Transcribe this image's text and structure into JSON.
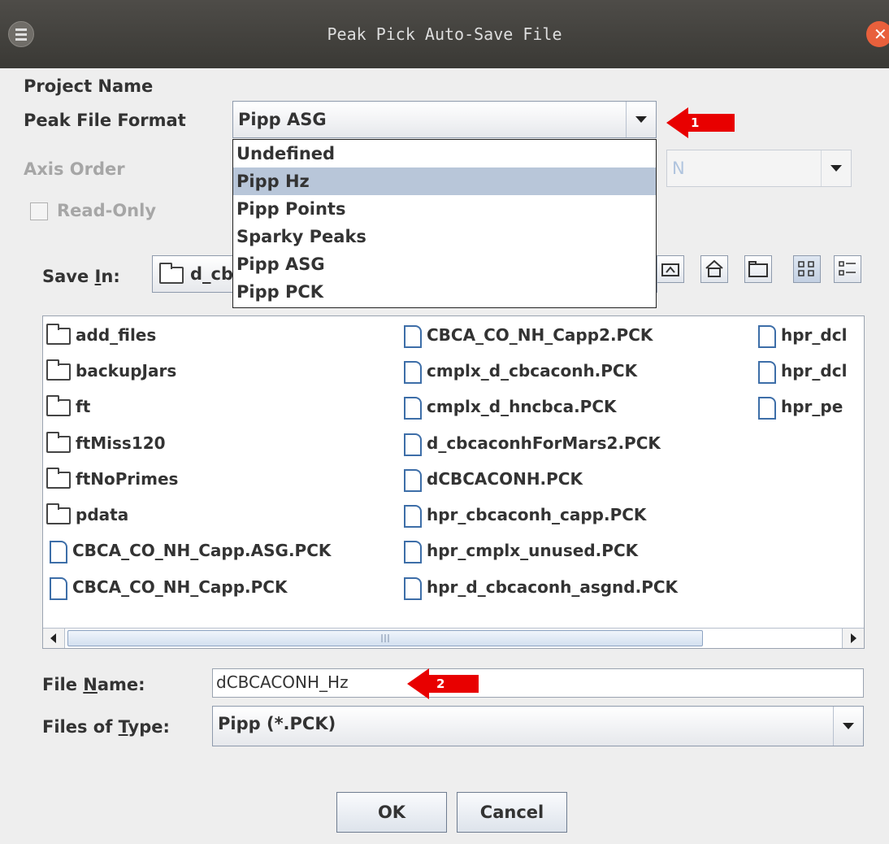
{
  "window": {
    "title": "Peak Pick Auto-Save File"
  },
  "fields": {
    "project_name_label": "Project Name",
    "peak_file_format_label": "Peak File Format",
    "peak_file_format_value": "Pipp ASG",
    "axis_order_label": "Axis Order",
    "axis_order_value": "N",
    "read_only_label": "Read-Only"
  },
  "format_options": [
    "Undefined",
    "Pipp Hz",
    "Pipp Points",
    "Sparky Peaks",
    "Pipp ASG",
    "Pipp PCK"
  ],
  "format_highlighted": "Pipp Hz",
  "save_in": {
    "label_pre": "Save ",
    "label_mnemonic": "I",
    "label_post": "n:",
    "value": "d_cb"
  },
  "files": {
    "col1": [
      "add_files",
      "backupJars",
      "ft",
      "ftMiss120",
      "ftNoPrimes",
      "pdata",
      "CBCA_CO_NH_Capp.ASG.PCK",
      "CBCA_CO_NH_Capp.PCK"
    ],
    "col2": [
      "CBCA_CO_NH_Capp2.PCK",
      "cmplx_d_cbcaconh.PCK",
      "cmplx_d_hncbca.PCK",
      "d_cbcaconhForMars2.PCK",
      "dCBCACONH.PCK",
      "hpr_cbcaconh_capp.PCK",
      "hpr_cmplx_unused.PCK",
      "hpr_d_cbcaconh_asgnd.PCK"
    ],
    "col3": [
      "hpr_dcl",
      "hpr_dcl",
      "hpr_pe"
    ]
  },
  "file_name": {
    "label_pre": "File ",
    "label_mnemonic": "N",
    "label_post": "ame:",
    "value": "dCBCACONH_Hz"
  },
  "files_of_type": {
    "label_pre": "Files of ",
    "label_mnemonic": "T",
    "label_post": "ype:",
    "value": "Pipp (*.PCK)"
  },
  "buttons": {
    "ok": "OK",
    "cancel": "Cancel"
  },
  "annotations": {
    "marker1": "1",
    "marker2": "2"
  },
  "colors": {
    "titlebar": "#3f3e3a",
    "selection": "#b8c6d9",
    "marker": "#e80000",
    "close": "#e8603c"
  }
}
